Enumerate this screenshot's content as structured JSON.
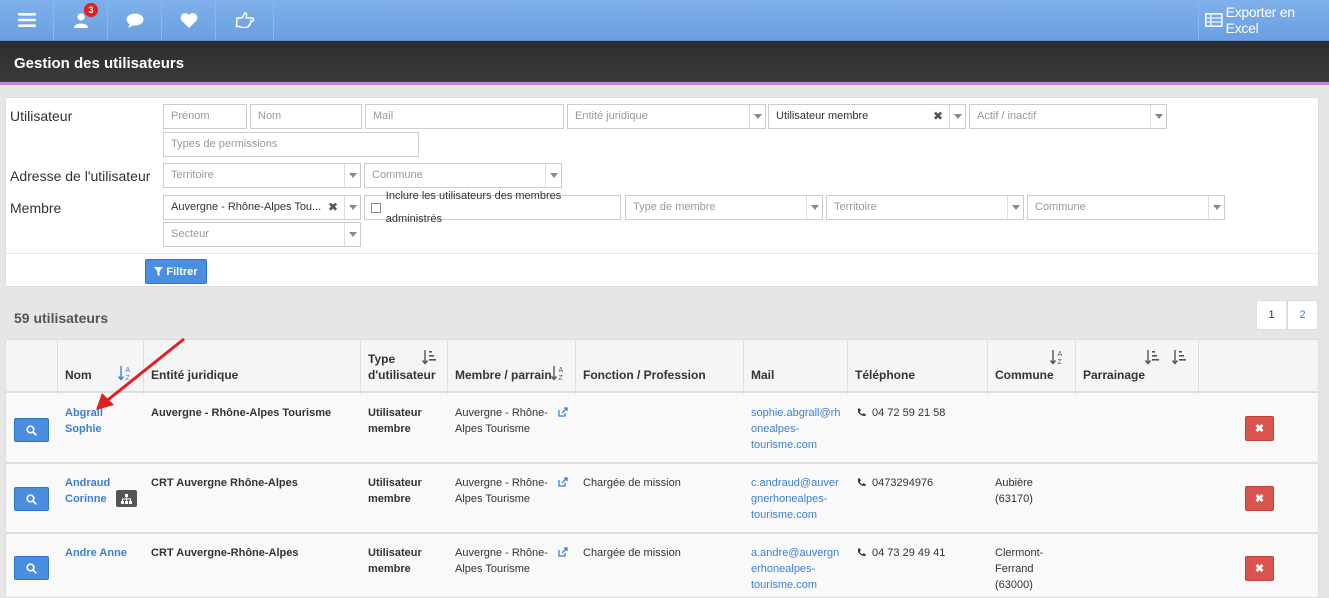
{
  "topnav": {
    "notification_count": "3",
    "export_label": "Exporter en Excel"
  },
  "page": {
    "title": "Gestion des utilisateurs"
  },
  "filters": {
    "utilisateur_label": "Utilisateur",
    "prenom_placeholder": "Prénom",
    "nom_placeholder": "Nom",
    "mail_placeholder": "Mail",
    "entite_placeholder": "Entité juridique",
    "utilisateur_membre_value": "Utilisateur membre",
    "actif_placeholder": "Actif / inactif",
    "permissions_placeholder": "Types de permissions",
    "adresse_label": "Adresse de l'utilisateur",
    "territoire_placeholder": "Territoire",
    "commune_placeholder": "Commune",
    "membre_label": "Membre",
    "membre_value": "Auvergne - Rhône-Alpes Tou...",
    "inclure_label": "Inclure les utilisateurs des membres administrés",
    "type_membre_placeholder": "Type de membre",
    "territoire2_placeholder": "Territoire",
    "commune2_placeholder": "Commune",
    "secteur_placeholder": "Secteur",
    "filter_button": "Filtrer"
  },
  "results": {
    "count_label": "59 utilisateurs",
    "pages": [
      "1",
      "2"
    ],
    "current_page": "1"
  },
  "table": {
    "headers": {
      "nom": "Nom",
      "entite": "Entité juridique",
      "type_line1": "Type",
      "type_line2": "d'utilisateur",
      "membre": "Membre / parrain",
      "fonction": "Fonction / Profession",
      "mail": "Mail",
      "telephone": "Téléphone",
      "commune": "Commune",
      "parrainage": "Parrainage"
    },
    "rows": [
      {
        "nom_line1": "Abgrall",
        "nom_line2": "Sophie",
        "entite": "Auvergne - Rhône-Alpes Tourisme",
        "type_line1": "Utilisateur",
        "type_line2": "membre",
        "membre_line1": "Auvergne - Rhône-",
        "membre_line2": "Alpes Tourisme",
        "fonction": "",
        "mail_line1": "sophie.abgrall@rh",
        "mail_line2": "onealpes-",
        "mail_line3": "tourisme.com",
        "telephone": "04 72 59 21 58",
        "commune_line1": "",
        "commune_line2": "",
        "commune_line3": ""
      },
      {
        "nom_line1": "Andraud",
        "nom_line2": "Corinne",
        "entite": "CRT Auvergne Rhône-Alpes",
        "type_line1": "Utilisateur",
        "type_line2": "membre",
        "membre_line1": "Auvergne - Rhône-",
        "membre_line2": "Alpes Tourisme",
        "fonction": "Chargée de mission",
        "mail_line1": "c.andraud@auver",
        "mail_line2": "gnerhonealpes-",
        "mail_line3": "tourisme.com",
        "telephone": "0473294976",
        "commune_line1": "Aubière",
        "commune_line2": "(63170)",
        "commune_line3": ""
      },
      {
        "nom_line1": "Andre Anne",
        "nom_line2": "",
        "entite": "CRT Auvergne-Rhône-Alpes",
        "type_line1": "Utilisateur",
        "type_line2": "membre",
        "membre_line1": "Auvergne - Rhône-",
        "membre_line2": "Alpes Tourisme",
        "fonction": "Chargée de mission",
        "mail_line1": "a.andre@auvergn",
        "mail_line2": "erhonealpes-",
        "mail_line3": "tourisme.com",
        "telephone": "04 73 29 49 41",
        "commune_line1": "Clermont-",
        "commune_line2": "Ferrand",
        "commune_line3": "(63000)"
      }
    ]
  },
  "colors": {
    "nav_blue": "#6a9fe0",
    "title_dark": "#333333",
    "accent_purple": "#b989d6",
    "link_blue": "#3c7fd6",
    "delete_red": "#d9534f",
    "annotation_arrow": "#e02020"
  }
}
